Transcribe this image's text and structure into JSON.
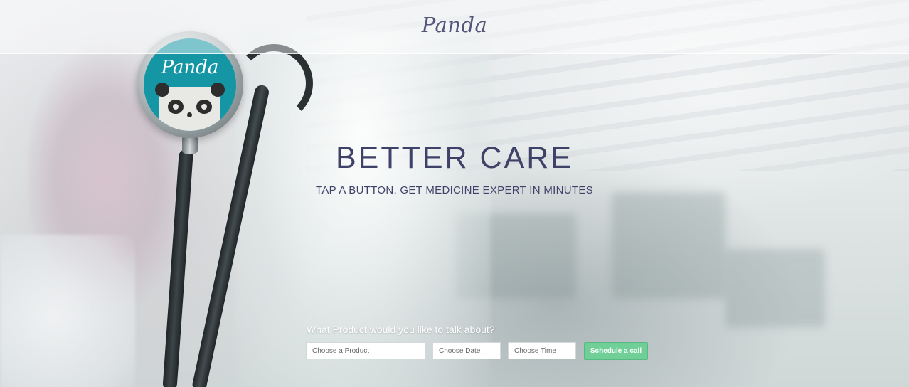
{
  "header": {
    "brand": "Panda"
  },
  "stethoscope": {
    "logo": "Panda"
  },
  "hero": {
    "headline": "BETTER CARE",
    "subheadline": "TAP A BUTTON, GET MEDICINE EXPERT IN MINUTES"
  },
  "schedule_form": {
    "prompt": "What Product would you like to talk about?",
    "product_placeholder": "Choose a Product",
    "date_placeholder": "Choose Date",
    "time_placeholder": "Choose Time",
    "submit_label": "Schedule a call"
  },
  "colors": {
    "brand_text": "#55557a",
    "headline_text": "#3f4268",
    "cta_green": "#6fcf97",
    "chest_teal": "#1596a5"
  }
}
